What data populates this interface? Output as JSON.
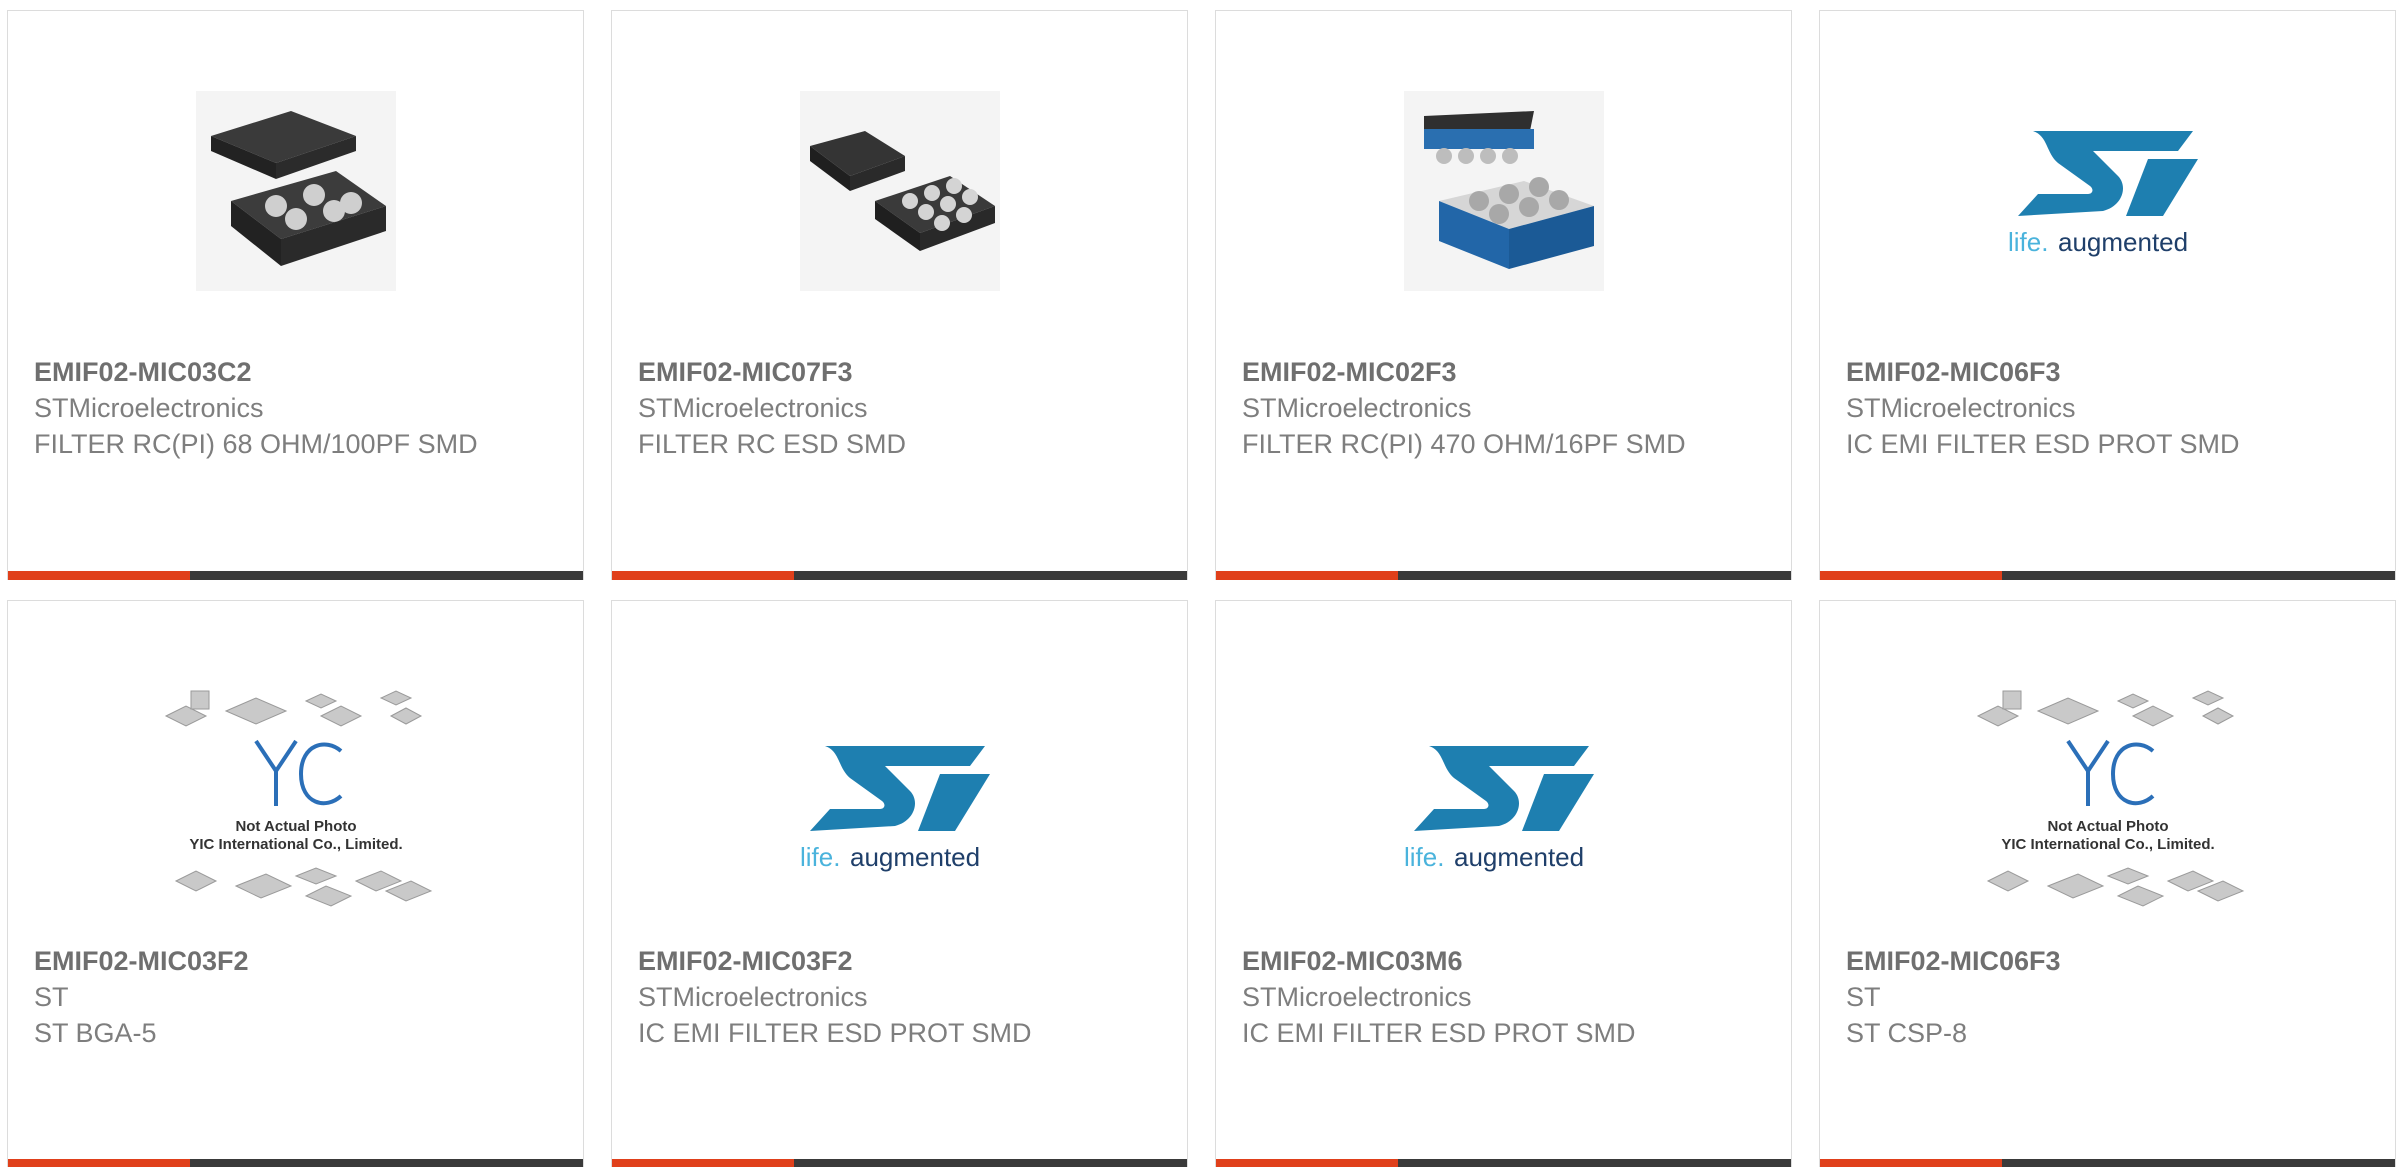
{
  "colors": {
    "accent": "#e0401b",
    "bar": "#3a3a3a",
    "st_blue": "#1e7fb0",
    "yic_blue": "#2b6fb8"
  },
  "products": [
    {
      "part": "EMIF02-MIC03C2",
      "manufacturer": "STMicroelectronics",
      "description": "FILTER RC(PI) 68 OHM/100PF SMD",
      "image": "bga-5-chip-icon"
    },
    {
      "part": "EMIF02-MIC07F3",
      "manufacturer": "STMicroelectronics",
      "description": "FILTER RC ESD SMD",
      "image": "flip-chip-8-icon"
    },
    {
      "part": "EMIF02-MIC02F3",
      "manufacturer": "STMicroelectronics",
      "description": "FILTER RC(PI) 470 OHM/16PF SMD",
      "image": "blue-csp-chip-icon"
    },
    {
      "part": "EMIF02-MIC06F3",
      "manufacturer": "STMicroelectronics",
      "description": "IC EMI FILTER ESD PROT SMD",
      "image": "st-logo",
      "logo_tagline_a": "life.",
      "logo_tagline_b": "augmented"
    },
    {
      "part": "EMIF02-MIC03F2",
      "manufacturer": "ST",
      "description": "ST BGA-5",
      "image": "yic-placeholder",
      "placeholder_line1": "Not Actual Photo",
      "placeholder_line2": "YIC International Co., Limited."
    },
    {
      "part": "EMIF02-MIC03F2",
      "manufacturer": "STMicroelectronics",
      "description": "IC EMI FILTER ESD PROT SMD",
      "image": "st-logo",
      "logo_tagline_a": "life.",
      "logo_tagline_b": "augmented"
    },
    {
      "part": "EMIF02-MIC03M6",
      "manufacturer": "STMicroelectronics",
      "description": "IC EMI FILTER ESD PROT SMD",
      "image": "st-logo",
      "logo_tagline_a": "life.",
      "logo_tagline_b": "augmented"
    },
    {
      "part": "EMIF02-MIC06F3",
      "manufacturer": "ST",
      "description": "ST CSP-8",
      "image": "yic-placeholder",
      "placeholder_line1": "Not Actual Photo",
      "placeholder_line2": "YIC International Co., Limited."
    }
  ]
}
